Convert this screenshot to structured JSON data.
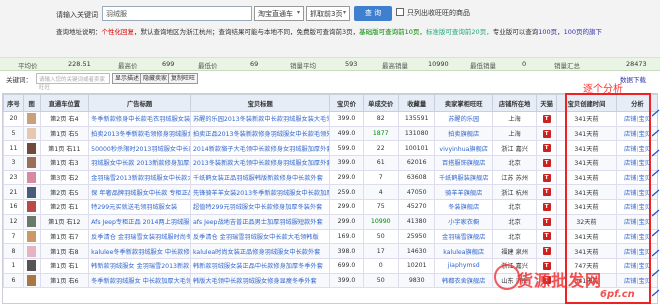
{
  "search": {
    "label": "请输入关键词",
    "value": "羽绒服",
    "platform": "淘宝直通车",
    "pages": "抓取前3页",
    "button": "查 询",
    "checkbox_label": "只列出收旺旺的商品"
  },
  "hint": {
    "p1": "查询地址说明：",
    "p2": "个性化回复",
    "p3": "，默认查询地区为浙江杭州；查询结果可能与本地不同，免费版可查询前3页，",
    "p4": "基础版可查询前10页，",
    "p5": "标准版可查询前20页，",
    "p6": "专业版可以查询",
    "p7": "100页",
    "p8": "，",
    "p9": "100页的旗下"
  },
  "stats": [
    {
      "key": "平均价",
      "value": "228.51"
    },
    {
      "key": "最高价",
      "value": "699"
    },
    {
      "key": "最低价",
      "value": "69"
    },
    {
      "key": "销量平均",
      "value": "593"
    },
    {
      "key": "最高销量",
      "value": "10990"
    },
    {
      "key": "最低销量",
      "value": "0"
    },
    {
      "key": "销量汇总",
      "value": "28473"
    }
  ],
  "filter": {
    "label": "关键词：",
    "placeholder": "请输入您的关键词或者卖家旺旺",
    "btn_show": "显示描述",
    "btn_hide": "隐藏卖家",
    "btn_copy": "复制旺旺",
    "download": "数据下载"
  },
  "annotation": "逐个分析",
  "watermark": {
    "main": "货源批发网",
    "sub": "6pf.cn"
  },
  "columns": [
    "序号",
    "图",
    "直通车位置",
    "广告标题",
    "宝贝标题",
    "宝贝价",
    "单成交价",
    "收藏量",
    "卖家掌柜旺旺",
    "店铺所在地",
    "天猫",
    "宝贝创建时间",
    "分析"
  ],
  "rows": [
    {
      "n": "20",
      "pos": "第2页 右4",
      "ad": "冬季新款修身中长款毛衣羽绒服女装外套",
      "title": "苏醒的乐园2013冬装新款中长款羽绒服女装大毛领",
      "price": "399.0",
      "deal": "82",
      "fav": "135591",
      "shop": "苏醒的乐园",
      "loc": "上海",
      "created": "341天前",
      "a1": "店铺",
      "a2": "宝贝"
    },
    {
      "n": "5",
      "pos": "第1页 右5",
      "ad": "拍卖2013冬季新款毛领修身羽绒服女中长款",
      "title": "拍卖正品2013冬装新款修身羽绒服女中长款毛领外套",
      "price": "499.0",
      "deal": "1877",
      "fav": "131080",
      "shop": "拍卖旗舰店",
      "loc": "上海",
      "created": "341天前",
      "a1": "店铺",
      "a2": "宝贝"
    },
    {
      "n": "11",
      "pos": "第1页 右11",
      "ad": "50000秒杀限时2013羽绒服女中长款",
      "title": "2014新款貉子大毛领中长款修身女羽绒服加厚外套",
      "price": "599.0",
      "deal": "22",
      "fav": "100101",
      "shop": "vivyinhua旗舰店",
      "loc": "浙江 嘉兴",
      "created": "341天前",
      "a1": "店铺",
      "a2": "宝贝"
    },
    {
      "n": "3",
      "pos": "第1页 右3",
      "ad": "羽绒服女中长款 2013新款修身加厚外套",
      "title": "2013冬装新款大毛领中长款修身羽绒服女加厚外套",
      "price": "399.0",
      "deal": "61",
      "fav": "62016",
      "shop": "百搭服饰旗舰店",
      "loc": "北京",
      "created": "341天前",
      "a1": "店铺",
      "a2": "宝贝"
    },
    {
      "n": "23",
      "pos": "第3页 右2",
      "ad": "金羽瑞雪2013新款羽绒服女中长款大毛领",
      "title": "千纸鹤女装正品羽绒服韩版新款修身中长款外套",
      "price": "299.0",
      "deal": "7",
      "fav": "63608",
      "shop": "千纸鹤服装旗舰店",
      "loc": "江苏 苏州",
      "created": "341天前",
      "a1": "店铺",
      "a2": "宝贝"
    },
    {
      "n": "21",
      "pos": "第2页 右5",
      "ad": "保 年奢品牌羽绒服女中长款 专柜正品",
      "title": "先锋骑羊羊女装2013冬季新款羽绒服女中长款加厚",
      "price": "259.0",
      "deal": "4",
      "fav": "47050",
      "shop": "骑羊羊旗舰店",
      "loc": "浙江 杭州",
      "created": "341天前",
      "a1": "店铺",
      "a2": "宝贝"
    },
    {
      "n": "16",
      "pos": "第2页 右1",
      "ad": "特299元买就送毛领羽绒服女装",
      "title": "超值特299元羽绒服女中长款修身加厚冬装外套",
      "price": "299.0",
      "deal": "75",
      "fav": "45270",
      "shop": "冬装旗舰店",
      "loc": "北京",
      "created": "341天前",
      "a1": "店铺",
      "a2": "宝贝"
    },
    {
      "n": "12",
      "pos": "第1页 右12",
      "ad": "Afs Jeep专柜正品 2014两上羽绒服女装",
      "title": "afs Jeep战地吉普正品男士加厚羽绒服短款外套",
      "price": "299.0",
      "deal": "10990",
      "fav": "41380",
      "shop": "小宇家衣橱",
      "loc": "北京",
      "created": "32天前",
      "a1": "店铺",
      "a2": "宝贝"
    },
    {
      "n": "7",
      "pos": "第1页 右7",
      "ad": "反季清仓 金羽瑞雪女装羽绒服时尚冬装",
      "title": "反季清仓 金羽瑞雪羽绒服女中长款大毛领韩版",
      "price": "169.0",
      "deal": "50",
      "fav": "25950",
      "shop": "金羽瑞雪旗舰店",
      "loc": "北京",
      "created": "341天前",
      "a1": "店铺",
      "a2": "宝贝"
    },
    {
      "n": "8",
      "pos": "第1页 右8",
      "ad": "kalulee冬季新款羽绒服女 中长款修身",
      "title": "kalulea时尚女装正品修身羽绒服女中长款外套",
      "price": "398.0",
      "deal": "17",
      "fav": "14630",
      "shop": "kalulea旗舰店",
      "loc": "福建 泉州",
      "created": "341天前",
      "a1": "店铺",
      "a2": "宝贝"
    },
    {
      "n": "1",
      "pos": "第1页 右1",
      "ad": "韩新款羽绒服女 金羽瑞雪2013新款",
      "title": "韩新款羽绒服女装正品中长款修身加厚冬季外套",
      "price": "699.0",
      "deal": "0",
      "fav": "10201",
      "shop": "jiaphymsd",
      "loc": "浙江 嘉兴",
      "created": "747天前",
      "a1": "店铺",
      "a2": "宝贝"
    },
    {
      "n": "6",
      "pos": "第1页 右6",
      "ad": "冬季新款羽绒服女 中长款加厚大毛领",
      "title": "韩版大毛领中长款羽绒服女修身显瘦冬季外套",
      "price": "399.0",
      "deal": "50",
      "fav": "9830",
      "shop": "韩都衣舍旗舰店",
      "loc": "山东 济南",
      "created": "341天前",
      "a1": "店铺",
      "a2": "宝贝"
    }
  ],
  "colors": {
    "accent": "#3f7fd0",
    "link": "#3366cc",
    "highlight": "#ee2222",
    "header_bg": "#e6edf7"
  }
}
